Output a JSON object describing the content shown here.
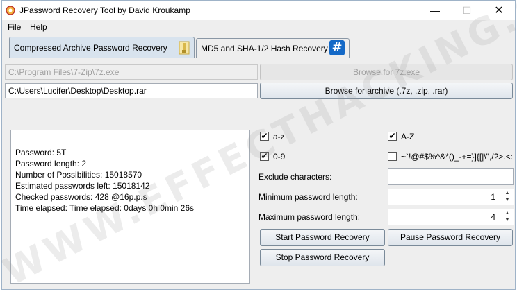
{
  "window": {
    "title": "JPassword Recovery Tool by David Kroukamp",
    "minimize": "—",
    "maximize": "☐",
    "close": "✕"
  },
  "menu": [
    "File",
    "Help"
  ],
  "tabs": [
    {
      "label": "Compressed Archive Password Recovery",
      "icon": "archive-icon",
      "active": true
    },
    {
      "label": "MD5 and SHA-1/2 Hash Recovery",
      "icon": "hash-icon",
      "active": false
    }
  ],
  "paths": {
    "seven_zip_path": "C:\\Program Files\\7-Zip\\7z.exe",
    "browse_7z_label": "Browse for 7z.exe",
    "archive_path": "C:\\Users\\Lucifer\\Desktop\\Desktop.rar",
    "browse_archive_label": "Browse for archive (.7z, .zip, .rar)"
  },
  "output": {
    "lines": [
      "Password: 5T",
      "Password length: 2",
      "Number of Possibilities: 15018570",
      "Estimated passwords left: 15018142",
      "Checked passwords: 428 @16p.p.s",
      "Time elapsed: Time elapsed: 0days 0h 0min 26s"
    ]
  },
  "options": {
    "lowercase": {
      "label": "a-z",
      "checked": true
    },
    "uppercase": {
      "label": "A-Z",
      "checked": true
    },
    "digits": {
      "label": "0-9",
      "checked": true
    },
    "symbols": {
      "label": "~`!@#$%^&*()_-+=}]{[|\\\",/?>.<:;",
      "checked": false
    },
    "exclude_label": "Exclude characters:",
    "exclude_value": "",
    "min_label": "Minimum password length:",
    "min_value": "1",
    "max_label": "Maximum password length:",
    "max_value": "4",
    "check_mark": "✔"
  },
  "buttons": {
    "start": "Start Password Recovery",
    "pause": "Pause Password Recovery",
    "stop": "Stop Password Recovery"
  },
  "watermark": "WWW.EFFECTHACKING.COM"
}
